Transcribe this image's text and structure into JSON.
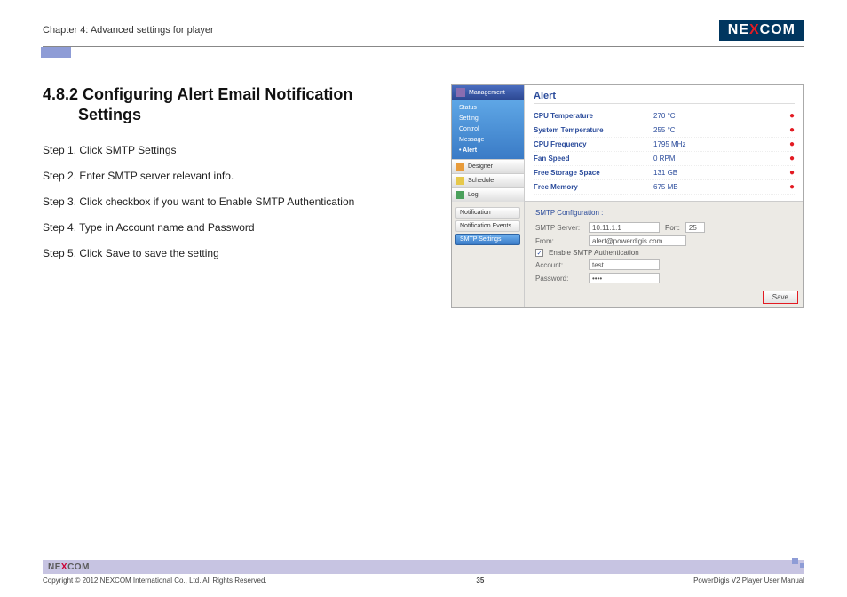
{
  "header": {
    "chapter": "Chapter 4: Advanced settings for player",
    "logo_pre": "NE",
    "logo_x": "X",
    "logo_post": "COM"
  },
  "section": {
    "title_line1": "4.8.2 Configuring Alert Email Notification",
    "title_line2": "Settings",
    "steps": [
      "Step 1. Click SMTP Settings",
      "Step 2. Enter SMTP server relevant info.",
      "Step 3. Click checkbox if you want to Enable SMTP Authentication",
      "Step 4. Type in Account name and Password",
      "Step 5. Click Save to save the setting"
    ]
  },
  "screenshot": {
    "sidebar": {
      "management": "Management",
      "items": [
        "Status",
        "Setting",
        "Control",
        "Message",
        "• Alert"
      ],
      "buttons": [
        {
          "label": "Designer"
        },
        {
          "label": "Schedule"
        },
        {
          "label": "Log"
        }
      ]
    },
    "alert_title": "Alert",
    "metrics": [
      {
        "name": "CPU Temperature",
        "value": "270 °C"
      },
      {
        "name": "System Temperature",
        "value": "255 °C"
      },
      {
        "name": "CPU Frequency",
        "value": "1795 MHz"
      },
      {
        "name": "Fan Speed",
        "value": "0 RPM"
      },
      {
        "name": "Free Storage Space",
        "value": "131 GB"
      },
      {
        "name": "Free Memory",
        "value": "675 MB"
      }
    ],
    "bottom_tabs": [
      "Notification",
      "Notification Events",
      "SMTP Settings"
    ],
    "smtp": {
      "title": "SMTP Configuration :",
      "server_label": "SMTP Server:",
      "server_value": "10.11.1.1",
      "port_label": "Port:",
      "port_value": "25",
      "from_label": "From:",
      "from_value": "alert@powerdigis.com",
      "enable_label": "Enable SMTP Authentication",
      "account_label": "Account:",
      "account_value": "test",
      "password_label": "Password:",
      "password_value": "••••",
      "save": "Save"
    }
  },
  "footer": {
    "logo_pre": "NE",
    "logo_x": "X",
    "logo_post": "COM",
    "copyright": "Copyright © 2012 NEXCOM International Co., Ltd. All Rights Reserved.",
    "page": "35",
    "manual": "PowerDigis V2 Player User Manual"
  }
}
